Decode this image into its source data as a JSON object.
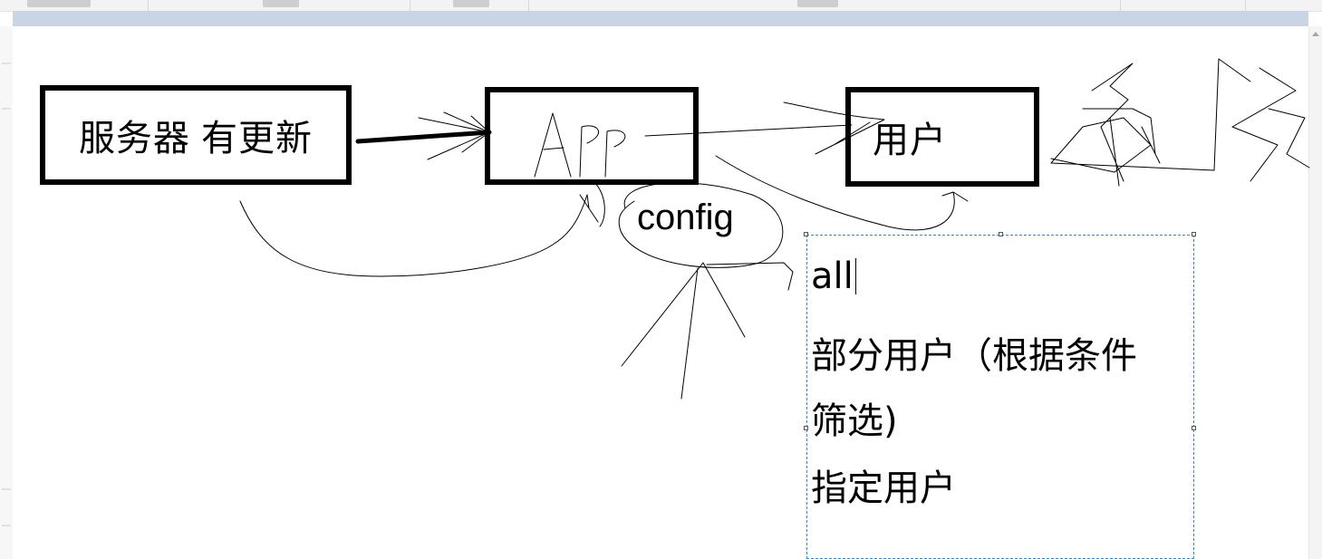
{
  "diagram": {
    "server_box_label": "服务器 有更新",
    "app_box_label": "",
    "user_box_label": "用户",
    "config_label": "config"
  },
  "textbox": {
    "lines": [
      "all",
      "部分用户（根据条件",
      "筛选)",
      "指定用户"
    ]
  },
  "colors": {
    "ink": "#000000",
    "selection_border": "#2b88d8",
    "ruler": "#c9d4e4"
  }
}
